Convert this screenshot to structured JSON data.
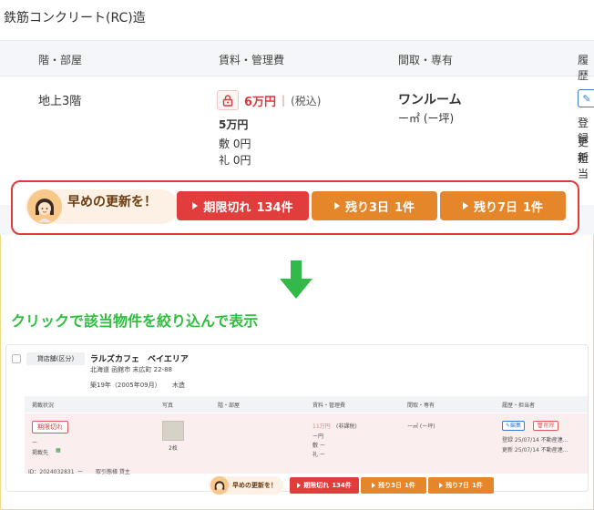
{
  "top": {
    "structure": "鉄筋コンクリート(RC)造",
    "headers": [
      "階・部屋",
      "賃料・管理費",
      "間取・専有",
      "履歴"
    ],
    "floor": "地上3階",
    "rent": "6万円",
    "rent_sep": "|",
    "tax": "(税込)",
    "price": "5万円",
    "shiki": "敷 0円",
    "rei": "礼 0円",
    "layout": "ワンルーム",
    "area": "ー㎡ (ー坪)",
    "history_1": "登録",
    "history_2": "更新",
    "history_3": "担当"
  },
  "notice": {
    "label": "早めの更新を！",
    "buttons": [
      {
        "label": "期限切れ",
        "count": "134件",
        "color": "#e23d3d"
      },
      {
        "label": "残り3日",
        "count": "1件",
        "color": "#e5862b"
      },
      {
        "label": "残り7日",
        "count": "1件",
        "color": "#e5862b"
      }
    ]
  },
  "caption": "クリックで該当物件を絞り込んで表示",
  "mini": {
    "tag": "貸店舗(区分)",
    "title": "ラルズカフェ　ベイエリア",
    "address": "北海道 函館市 末広町 22-88",
    "built": "築19年（2005年09月）",
    "construction": "木造",
    "headers": [
      "掲載状況",
      "写真",
      "階・部屋",
      "賃料・管理費",
      "間取・専有",
      "履歴・担当者"
    ],
    "status": "期限切れ",
    "dash": "ー",
    "published": "掲載先",
    "photo_count": "2枚",
    "rent": "11万円",
    "rent_tax": "(非課税)",
    "fee": "ー円",
    "shiki": "敷 ー",
    "rei": "礼 ー",
    "area": "ー㎡ (ー坪)",
    "edit": "編集",
    "delete": "削除",
    "reg": "登録 25/07/14  不動産連…",
    "upd": "更新 25/07/14  不動産連…",
    "id": "ID：2024032831",
    "id_dash": "ー",
    "deal": "取引態様  貸主"
  }
}
